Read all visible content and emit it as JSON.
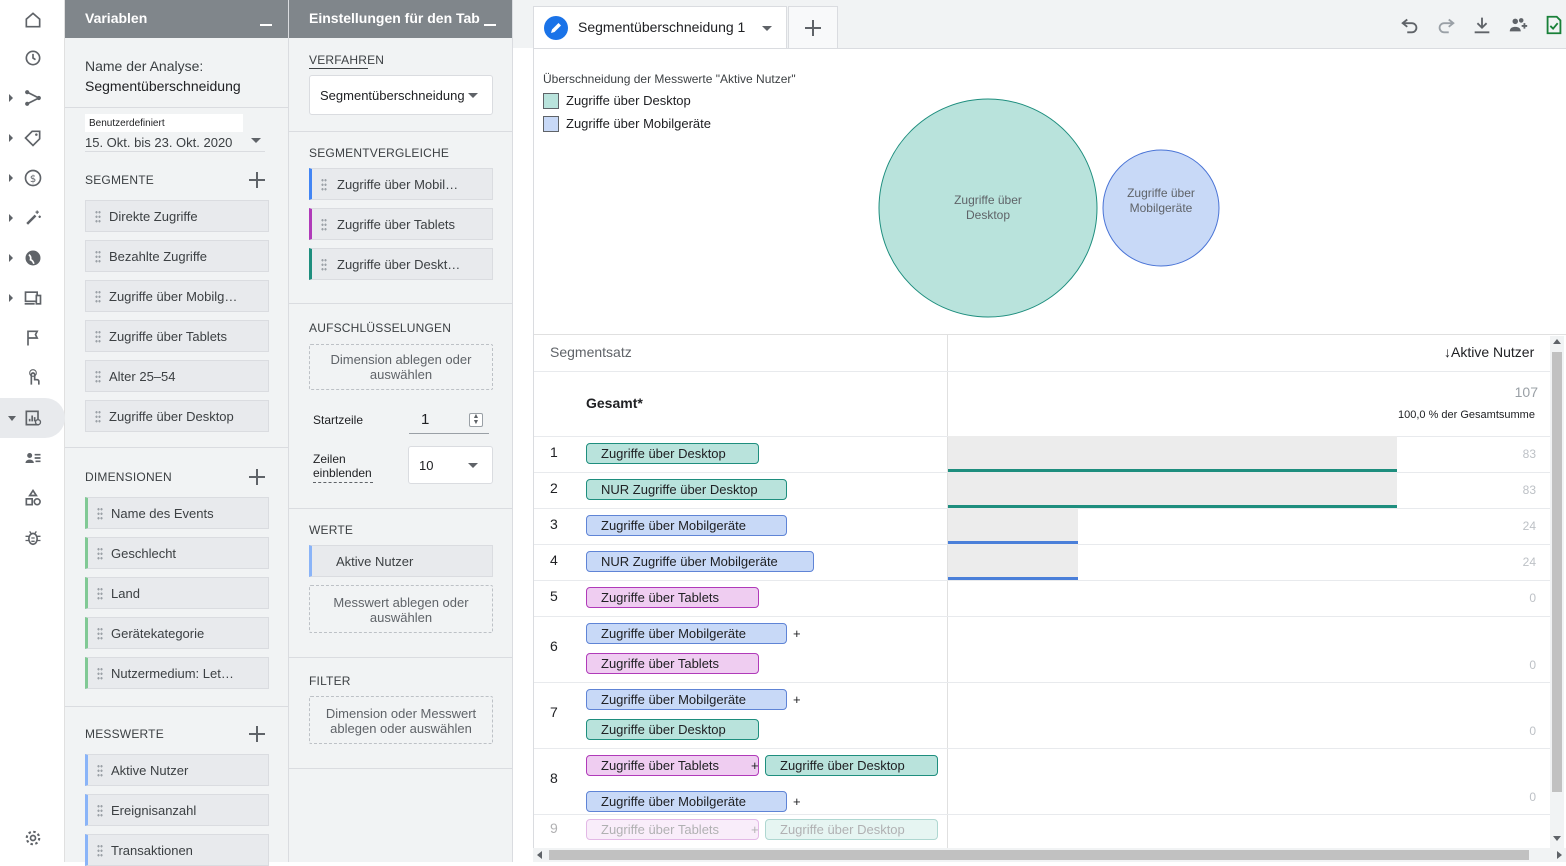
{
  "nav": {
    "items": [
      "home",
      "reports",
      "explore",
      "tags",
      "monetization",
      "advertising",
      "globe",
      "devices",
      "flag",
      "touch",
      "analysis",
      "users",
      "shapes",
      "debug",
      "settings"
    ]
  },
  "variables": {
    "title": "Variablen",
    "analysis_name_label": "Name der Analyse:",
    "analysis_name": "Segmentüberschneidung",
    "date_label": "Benutzerdefiniert",
    "date_range": "15. Okt. bis 23. Okt. 2020",
    "segments_header": "SEGMENTE",
    "segments": [
      "Direkte Zugriffe",
      "Bezahlte Zugriffe",
      "Zugriffe über Mobilg…",
      "Zugriffe über Tablets",
      "Alter 25–54",
      "Zugriffe über Desktop"
    ],
    "dimensions_header": "DIMENSIONEN",
    "dimensions": [
      "Name des Events",
      "Geschlecht",
      "Land",
      "Gerätekategorie",
      "Nutzermedium: Let…"
    ],
    "metrics_header": "MESSWERTE",
    "metrics": [
      "Aktive Nutzer",
      "Ereignisanzahl",
      "Transaktionen"
    ]
  },
  "settings": {
    "title": "Einstellungen für den Tab",
    "technique_header": "VERFAHREN",
    "technique": "Segmentüberschneidung",
    "comparisons_header": "SEGMENTVERGLEICHE",
    "comparisons": [
      "Zugriffe über Mobil…",
      "Zugriffe über Tablets",
      "Zugriffe über Deskt…"
    ],
    "comparison_colors": [
      "#4285f4",
      "#b03ab9",
      "#1e8e7e"
    ],
    "breakdowns_header": "AUFSCHLÜSSELUNGEN",
    "breakdown_drop": "Dimension ablegen oder auswählen",
    "start_row_label": "Startzeile",
    "start_row": "1",
    "show_rows_label": "Zeilen einblenden",
    "show_rows": "10",
    "values_header": "WERTE",
    "value": "Aktive Nutzer",
    "metric_drop": "Messwert ablegen oder auswählen",
    "filter_header": "FILTER",
    "filter_drop": "Dimension oder Messwert ablegen oder auswählen"
  },
  "tab": {
    "name": "Segmentüberschneidung 1"
  },
  "toolbar": [
    "undo-icon",
    "redo-icon",
    "download-icon",
    "share-icon",
    "export-icon"
  ],
  "venn": {
    "title": "Überschneidung der Messwerte \"Aktive Nutzer\"",
    "legend": [
      {
        "label": "Zugriffe über Desktop",
        "color": "#b9e3dc"
      },
      {
        "label": "Zugriffe über Mobilgeräte",
        "color": "#c8d9f7"
      }
    ],
    "circle_desktop": "Zugriffe über Desktop",
    "circle_mobile": "Zugriffe über Mobilgeräte"
  },
  "table": {
    "col_segment": "Segmentsatz",
    "col_metric": "Aktive Nutzer",
    "total_label": "Gesamt*",
    "total_value": "107",
    "total_pct": "100,0 % der Gesamtsumme",
    "rows": [
      {
        "n": "1",
        "labels": [
          "Zugriffe über Desktop"
        ],
        "value": "83"
      },
      {
        "n": "2",
        "labels": [
          "NUR Zugriffe über Desktop"
        ],
        "value": "83"
      },
      {
        "n": "3",
        "labels": [
          "Zugriffe über Mobilgeräte"
        ],
        "value": "24"
      },
      {
        "n": "4",
        "labels": [
          "NUR Zugriffe über Mobilgeräte"
        ],
        "value": "24"
      },
      {
        "n": "5",
        "labels": [
          "Zugriffe über Tablets"
        ],
        "value": "0"
      },
      {
        "n": "6",
        "labels": [
          "Zugriffe über Mobilgeräte",
          "Zugriffe über Tablets"
        ],
        "value": "0"
      },
      {
        "n": "7",
        "labels": [
          "Zugriffe über Mobilgeräte",
          "Zugriffe über Desktop"
        ],
        "value": "0"
      },
      {
        "n": "8",
        "labels": [
          "Zugriffe über Tablets",
          "Zugriffe über Desktop",
          "Zugriffe über Mobilgeräte"
        ],
        "value": "0"
      },
      {
        "n": "9",
        "labels": [
          "Zugriffe über Tablets",
          "Zugriffe über Desktop"
        ],
        "value": ""
      }
    ]
  }
}
